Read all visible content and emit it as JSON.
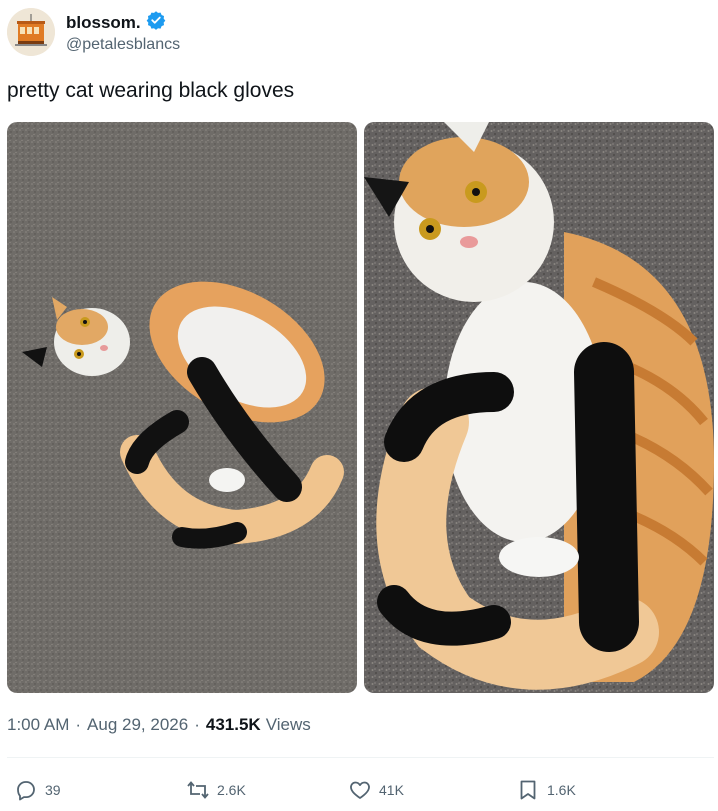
{
  "author": {
    "display_name": "blossom.",
    "handle": "@petalesblancs",
    "verified": true,
    "avatar_icon": "tram-avatar-icon",
    "verified_color": "#1d9bf0"
  },
  "tweet": {
    "text": "pretty cat wearing black gloves"
  },
  "media": [
    {
      "description_icon": "cat-photo-full"
    },
    {
      "description_icon": "cat-photo-closeup"
    }
  ],
  "meta": {
    "time": "1:00 AM",
    "separator": "·",
    "date": "Aug 29, 2026",
    "views_count": "431.5K",
    "views_label": "Views"
  },
  "actions": {
    "replies": "39",
    "reposts": "2.6K",
    "likes": "41K",
    "bookmarks": "1.6K"
  },
  "colors": {
    "text_primary": "#0f1419",
    "text_secondary": "#536471",
    "divider": "#eff3f4"
  }
}
